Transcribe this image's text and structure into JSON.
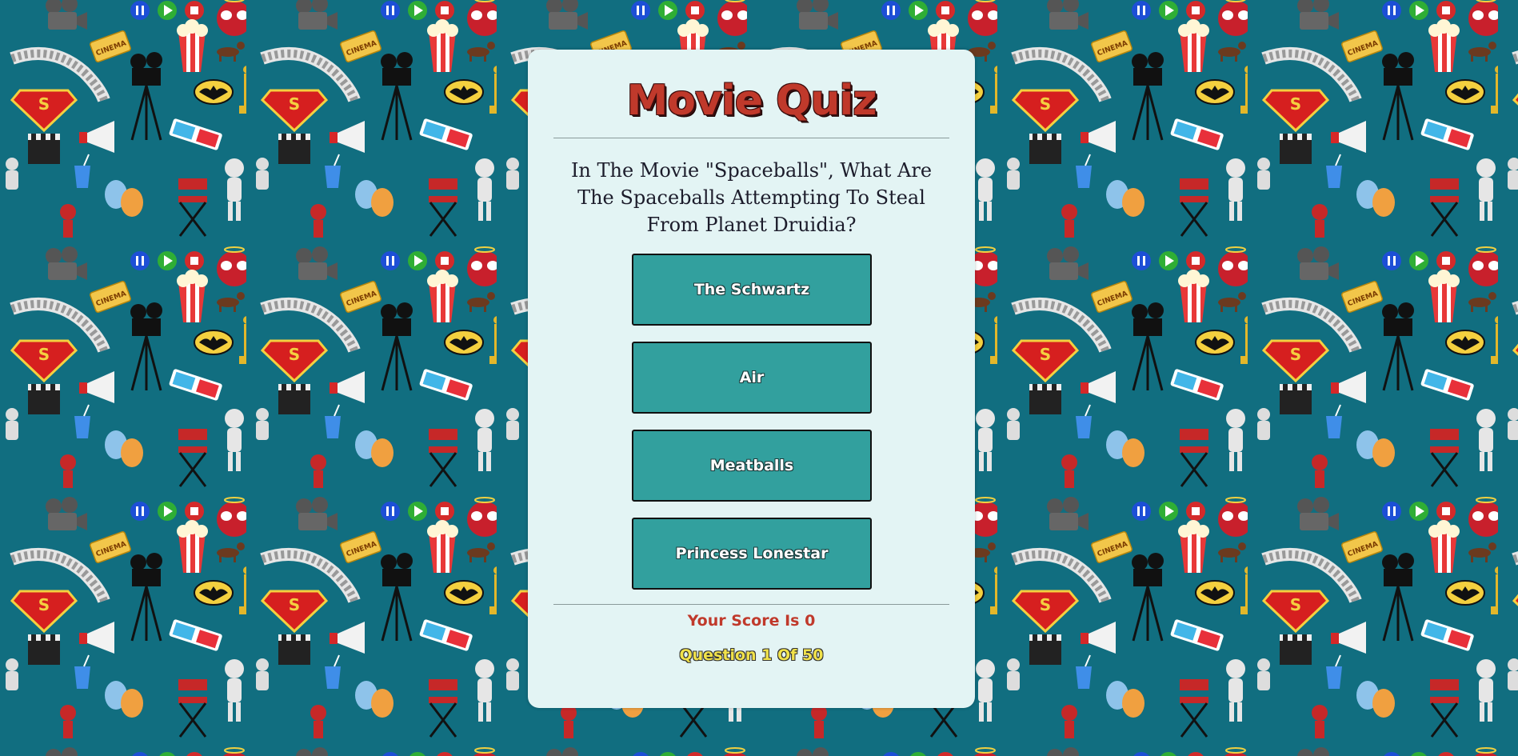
{
  "app": {
    "title": "Movie Quiz",
    "title_color": "#c0392b",
    "background_color": "#116e80",
    "card_color": "#e3f4f4"
  },
  "quiz": {
    "question": "In The Movie \"Spaceballs\", What Are The Spaceballs Attempting To Steal From Planet Druidia?",
    "answers": [
      {
        "label": "The Schwartz"
      },
      {
        "label": "Air"
      },
      {
        "label": "Meatballs"
      },
      {
        "label": "Princess Lonestar"
      }
    ],
    "answer_button_color": "#32a09e"
  },
  "footer": {
    "score_text": "Your Score Is 0",
    "progress_text": "Question 1 Of 50",
    "score_color": "#c0392b",
    "progress_color": "#f1e24a"
  },
  "background_pattern": {
    "icons": [
      "pause-button-icon",
      "play-button-icon",
      "stop-button-icon",
      "mask-face-icon",
      "film-camera-icon",
      "cinema-ticket-icon",
      "popcorn-icon",
      "dog-icon",
      "film-strip-icon",
      "movie-projector-icon",
      "superman-logo-icon",
      "batman-logo-icon",
      "oscar-statue-icon",
      "megaphone-icon",
      "3d-glasses-icon",
      "clapperboard-icon",
      "soda-cup-icon",
      "theatre-masks-icon",
      "directors-chair-icon",
      "figure-with-popcorn-icon",
      "spider-figure-icon"
    ]
  }
}
